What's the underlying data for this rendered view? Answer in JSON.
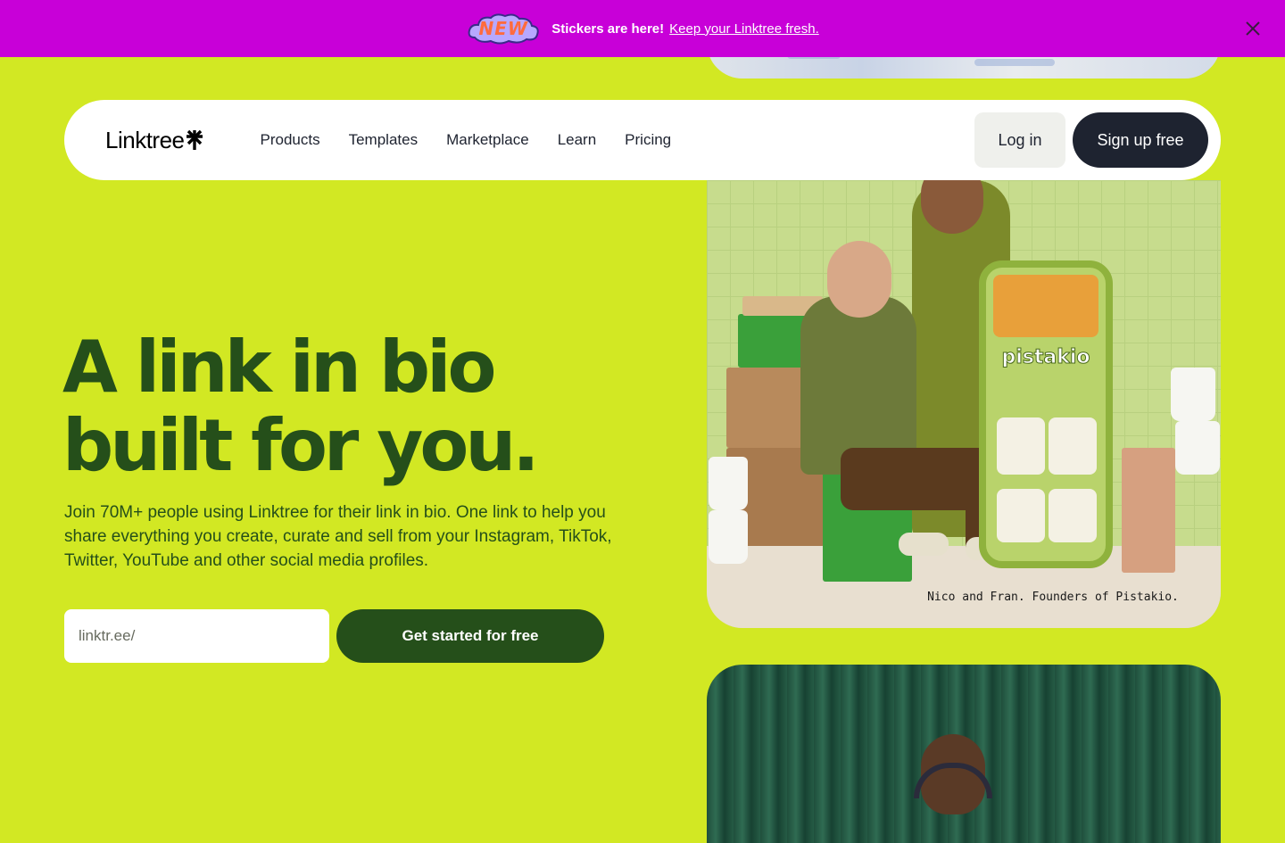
{
  "banner": {
    "sticker_label": "NEW",
    "message": "Stickers are here!",
    "link_text": "Keep your Linktree fresh.",
    "close_icon": "close-icon",
    "background": "#c800d8"
  },
  "nav": {
    "logo_text": "Linktree",
    "logo_icon": "asterisk-logo-icon",
    "links": [
      "Products",
      "Templates",
      "Marketplace",
      "Learn",
      "Pricing"
    ],
    "login_label": "Log in",
    "signup_label": "Sign up free"
  },
  "hero": {
    "title_line1": "A link in bio",
    "title_line2": "built for you.",
    "subtitle": "Join 70M+ people using Linktree for their link in bio. One link to help you share everything you create, curate and sell from your Instagram, TikTok, Twitter, YouTube and other social media profiles.",
    "input_placeholder": "linktr.ee/",
    "cta_label": "Get started for free"
  },
  "photo": {
    "caption": "Nico and Fran. Founders of Pistakio.",
    "phone_brand": "pistakio"
  },
  "colors": {
    "page_bg": "#d2e823",
    "hero_text": "#254f1a",
    "nav_dark": "#1e2330"
  }
}
